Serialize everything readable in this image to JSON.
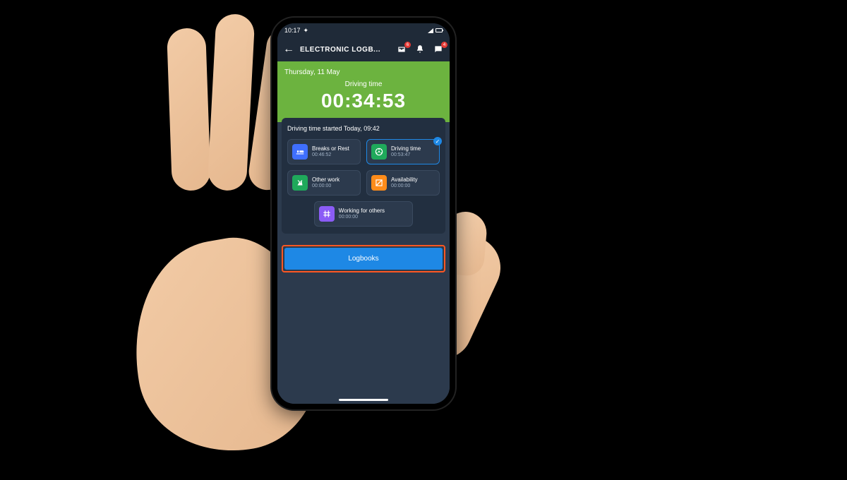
{
  "status": {
    "time": "10:17"
  },
  "header": {
    "title": "ELECTRONIC LOGB...",
    "badge_inbox": "6",
    "badge_chat": "4"
  },
  "banner": {
    "date": "Thursday, 11 May",
    "label": "Driving time",
    "timer": "00:34:53"
  },
  "started": "Driving time started Today, 09:42",
  "tiles": {
    "breaks": {
      "label": "Breaks or Rest",
      "time": "00:46:52"
    },
    "driving": {
      "label": "Driving time",
      "time": "00:53:47"
    },
    "other": {
      "label": "Other work",
      "time": "00:00:00"
    },
    "avail": {
      "label": "Availability",
      "time": "00:00:00"
    },
    "others": {
      "label": "Working for others",
      "time": "00:00:00"
    }
  },
  "logbooks_label": "Logbooks"
}
